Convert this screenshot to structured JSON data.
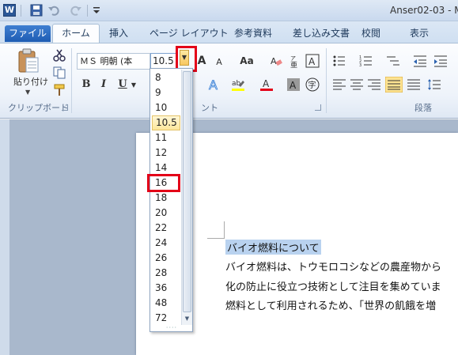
{
  "window": {
    "title": "Anser02-03 - M"
  },
  "quick_access": {
    "app_icon": "word-icon",
    "save_icon": "save-icon",
    "undo_icon": "undo-icon",
    "redo_icon": "redo-icon",
    "menu_icon": "chevron-down-icon"
  },
  "tabs": [
    {
      "label": "ファイル"
    },
    {
      "label": "ホーム"
    },
    {
      "label": "挿入"
    },
    {
      "label": "ページ レイアウト"
    },
    {
      "label": "参考資料"
    },
    {
      "label": "差し込み文書"
    },
    {
      "label": "校閲"
    },
    {
      "label": "表示"
    }
  ],
  "ribbon": {
    "clipboard": {
      "paste_label": "貼り付け",
      "group_label": "クリップボード"
    },
    "font": {
      "font_name": "ＭＳ 明朝 (本",
      "font_size": "10.5",
      "group_label_partial": "ント"
    },
    "paragraph": {
      "group_label": "段落"
    },
    "buttons": {
      "bold": "B",
      "italic": "I",
      "underline": "U",
      "aa": "Aa",
      "grow": "A",
      "shrink": "A",
      "font_color": "A",
      "char_shading": "A",
      "enclose": "字",
      "phonetic": "ア"
    }
  },
  "font_size_list": {
    "items": [
      "8",
      "9",
      "10",
      "10.5",
      "11",
      "12",
      "14",
      "16",
      "18",
      "20",
      "22",
      "24",
      "26",
      "28",
      "36",
      "48",
      "72"
    ],
    "selected": "10.5",
    "highlighted": "16"
  },
  "document": {
    "heading": "バイオ燃料について",
    "lines": [
      "バイオ燃料は、トウモロコシなどの農産物から",
      "化の防止に役立つ技術として注目を集めていま",
      "燃料として利用されるため、「世界の飢餓を増"
    ]
  },
  "colors": {
    "highlight_red": "#e30018",
    "file_tab": "#1e5cb3",
    "selection": "#b9d2ef"
  }
}
